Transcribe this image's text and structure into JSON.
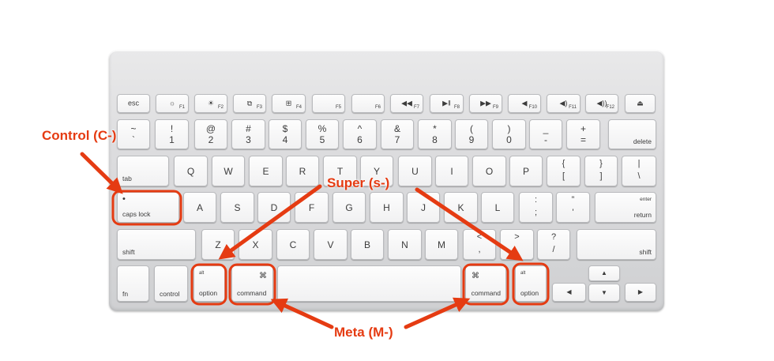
{
  "keyboard": {
    "rows": [
      [
        {
          "id": "esc",
          "labels": [
            "esc"
          ]
        },
        {
          "id": "f1",
          "labels": [
            "☼",
            "F1"
          ]
        },
        {
          "id": "f2",
          "labels": [
            "☀",
            "F2"
          ]
        },
        {
          "id": "f3",
          "labels": [
            "⧉",
            "F3"
          ]
        },
        {
          "id": "f4",
          "labels": [
            "⊞",
            "F4"
          ]
        },
        {
          "id": "f5",
          "labels": [
            "",
            "F5"
          ]
        },
        {
          "id": "f6",
          "labels": [
            "",
            "F6"
          ]
        },
        {
          "id": "f7",
          "labels": [
            "◀◀",
            "F7"
          ]
        },
        {
          "id": "f8",
          "labels": [
            "▶‖",
            "F8"
          ]
        },
        {
          "id": "f9",
          "labels": [
            "▶▶",
            "F9"
          ]
        },
        {
          "id": "f10",
          "labels": [
            "◀",
            "F10"
          ]
        },
        {
          "id": "f11",
          "labels": [
            "◀)",
            "F11"
          ]
        },
        {
          "id": "f12",
          "labels": [
            "◀))",
            "F12"
          ]
        },
        {
          "id": "eject",
          "labels": [
            "⏏"
          ]
        }
      ],
      [
        {
          "id": "tilde",
          "labels": [
            "~",
            "`"
          ]
        },
        {
          "id": "1",
          "labels": [
            "!",
            "1"
          ]
        },
        {
          "id": "2",
          "labels": [
            "@",
            "2"
          ]
        },
        {
          "id": "3",
          "labels": [
            "#",
            "3"
          ]
        },
        {
          "id": "4",
          "labels": [
            "$",
            "4"
          ]
        },
        {
          "id": "5",
          "labels": [
            "%",
            "5"
          ]
        },
        {
          "id": "6",
          "labels": [
            "^",
            "6"
          ]
        },
        {
          "id": "7",
          "labels": [
            "&",
            "7"
          ]
        },
        {
          "id": "8",
          "labels": [
            "*",
            "8"
          ]
        },
        {
          "id": "9",
          "labels": [
            "(",
            "9"
          ]
        },
        {
          "id": "0",
          "labels": [
            ")",
            "0"
          ]
        },
        {
          "id": "minus",
          "labels": [
            "_",
            "-"
          ]
        },
        {
          "id": "equal",
          "labels": [
            "+",
            "="
          ]
        },
        {
          "id": "delete",
          "labels": [
            "delete"
          ]
        }
      ],
      [
        {
          "id": "tab",
          "labels": [
            "tab"
          ]
        },
        {
          "id": "q",
          "labels": [
            "Q"
          ]
        },
        {
          "id": "w",
          "labels": [
            "W"
          ]
        },
        {
          "id": "e",
          "labels": [
            "E"
          ]
        },
        {
          "id": "r",
          "labels": [
            "R"
          ]
        },
        {
          "id": "t",
          "labels": [
            "T"
          ]
        },
        {
          "id": "y",
          "labels": [
            "Y"
          ]
        },
        {
          "id": "u",
          "labels": [
            "U"
          ]
        },
        {
          "id": "i",
          "labels": [
            "I"
          ]
        },
        {
          "id": "o",
          "labels": [
            "O"
          ]
        },
        {
          "id": "p",
          "labels": [
            "P"
          ]
        },
        {
          "id": "lbracket",
          "labels": [
            "{",
            "["
          ]
        },
        {
          "id": "rbracket",
          "labels": [
            "}",
            "]"
          ]
        },
        {
          "id": "backslash",
          "labels": [
            "|",
            "\\"
          ]
        }
      ],
      [
        {
          "id": "capslock",
          "labels": [
            "•",
            "caps lock"
          ]
        },
        {
          "id": "a",
          "labels": [
            "A"
          ]
        },
        {
          "id": "s",
          "labels": [
            "S"
          ]
        },
        {
          "id": "d",
          "labels": [
            "D"
          ]
        },
        {
          "id": "f",
          "labels": [
            "F"
          ]
        },
        {
          "id": "g",
          "labels": [
            "G"
          ]
        },
        {
          "id": "h",
          "labels": [
            "H"
          ]
        },
        {
          "id": "j",
          "labels": [
            "J"
          ]
        },
        {
          "id": "k",
          "labels": [
            "K"
          ]
        },
        {
          "id": "l",
          "labels": [
            "L"
          ]
        },
        {
          "id": "semicolon",
          "labels": [
            ":",
            ";"
          ]
        },
        {
          "id": "quote",
          "labels": [
            "”",
            "'"
          ]
        },
        {
          "id": "return",
          "labels": [
            "enter",
            "return"
          ]
        }
      ],
      [
        {
          "id": "lshift",
          "labels": [
            "shift"
          ]
        },
        {
          "id": "z",
          "labels": [
            "Z"
          ]
        },
        {
          "id": "x",
          "labels": [
            "X"
          ]
        },
        {
          "id": "c",
          "labels": [
            "C"
          ]
        },
        {
          "id": "v",
          "labels": [
            "V"
          ]
        },
        {
          "id": "b",
          "labels": [
            "B"
          ]
        },
        {
          "id": "n",
          "labels": [
            "N"
          ]
        },
        {
          "id": "m",
          "labels": [
            "M"
          ]
        },
        {
          "id": "comma",
          "labels": [
            "<",
            ","
          ]
        },
        {
          "id": "period",
          "labels": [
            ">",
            "."
          ]
        },
        {
          "id": "slash",
          "labels": [
            "?",
            "/"
          ]
        },
        {
          "id": "rshift",
          "labels": [
            "shift"
          ]
        }
      ],
      [
        {
          "id": "fn",
          "labels": [
            "fn"
          ]
        },
        {
          "id": "control",
          "labels": [
            "control"
          ]
        },
        {
          "id": "loption",
          "labels": [
            "alt",
            "option"
          ]
        },
        {
          "id": "lcommand",
          "labels": [
            "⌘",
            "command"
          ]
        },
        {
          "id": "space",
          "labels": []
        },
        {
          "id": "rcommand",
          "labels": [
            "⌘",
            "command"
          ]
        },
        {
          "id": "roption",
          "labels": [
            "alt",
            "option"
          ]
        },
        {
          "id": "left",
          "labels": [
            "◀"
          ]
        },
        {
          "id": "up",
          "labels": [
            "▲"
          ]
        },
        {
          "id": "down",
          "labels": [
            "▼"
          ]
        },
        {
          "id": "right",
          "labels": [
            "▶"
          ]
        }
      ]
    ]
  },
  "annotations": {
    "control": "Control (C-)",
    "super": "Super (s-)",
    "meta": "Meta (M-)"
  },
  "colors": {
    "highlight": "#e53b12"
  }
}
